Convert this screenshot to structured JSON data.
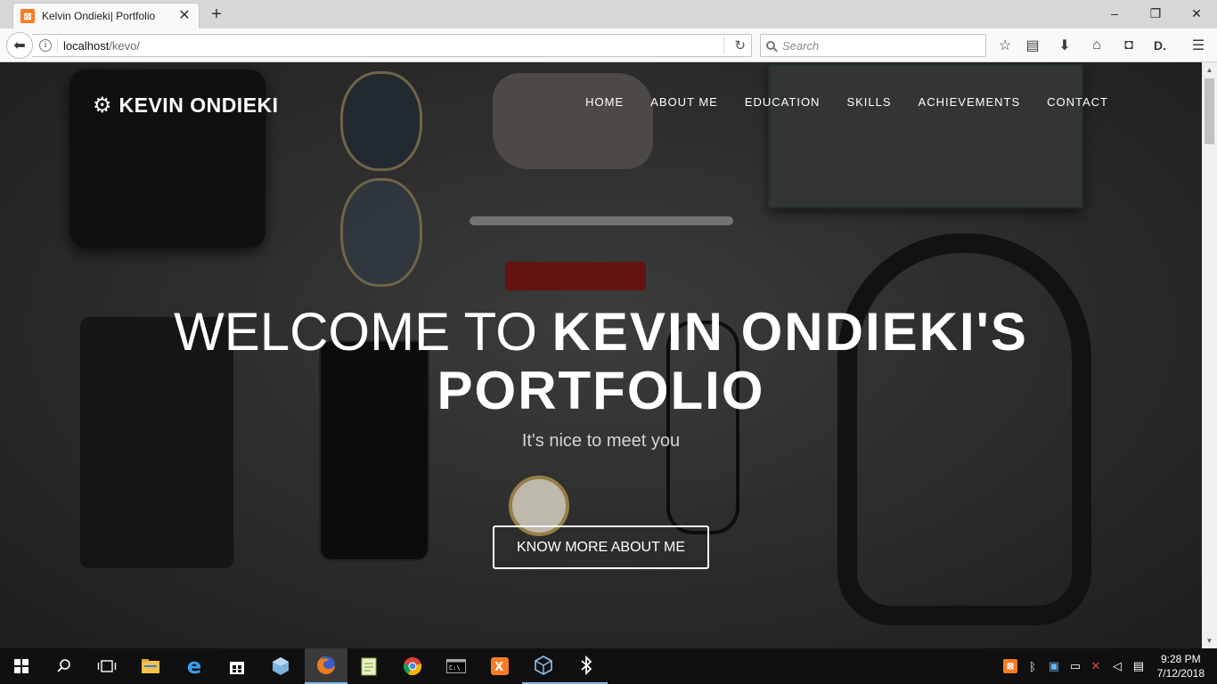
{
  "browser": {
    "tab": {
      "title": "Kelvin Ondieki| Portfolio",
      "favicon": "xampp-icon",
      "close_glyph": "✕"
    },
    "new_tab_glyph": "+",
    "window_controls": {
      "minimize": "–",
      "maximize": "❐",
      "close": "✕"
    },
    "url": {
      "host": "localhost",
      "path": "/kevo/"
    },
    "search": {
      "placeholder": "Search"
    },
    "toolbar_icons": [
      "bookmark-star-icon",
      "reading-list-icon",
      "download-icon",
      "home-icon",
      "pocket-icon",
      "extension-icon",
      "menu-icon"
    ]
  },
  "site": {
    "brand": {
      "icon": "gear-icon",
      "name": "KEVIN ONDIEKI"
    },
    "nav": [
      "HOME",
      "ABOUT ME",
      "EDUCATION",
      "SKILLS",
      "ACHIEVEMENTS",
      "CONTACT"
    ],
    "hero": {
      "title_lead": "WELCOME TO ",
      "title_strong_1": "KEVIN ONDIEKI'S",
      "title_strong_2": "PORTFOLIO",
      "subtitle": "It's nice to meet you",
      "cta": "KNOW MORE ABOUT ME"
    }
  },
  "taskbar": {
    "apps": [
      "windows-start-icon",
      "search-icon",
      "task-view-icon",
      "file-explorer-icon",
      "edge-icon",
      "store-icon",
      "virtualbox-icon",
      "firefox-icon",
      "notepad-plus-plus-icon",
      "chrome-icon",
      "cmd-icon",
      "xampp-icon",
      "virtualbox-manager-icon",
      "bluetooth-icon"
    ],
    "clock": {
      "time": "9:28 PM",
      "date": "7/12/2018"
    }
  },
  "colors": {
    "xampp_orange": "#fb7a24",
    "taskbar": "#101010",
    "accent_blue": "#7fb6e8"
  }
}
